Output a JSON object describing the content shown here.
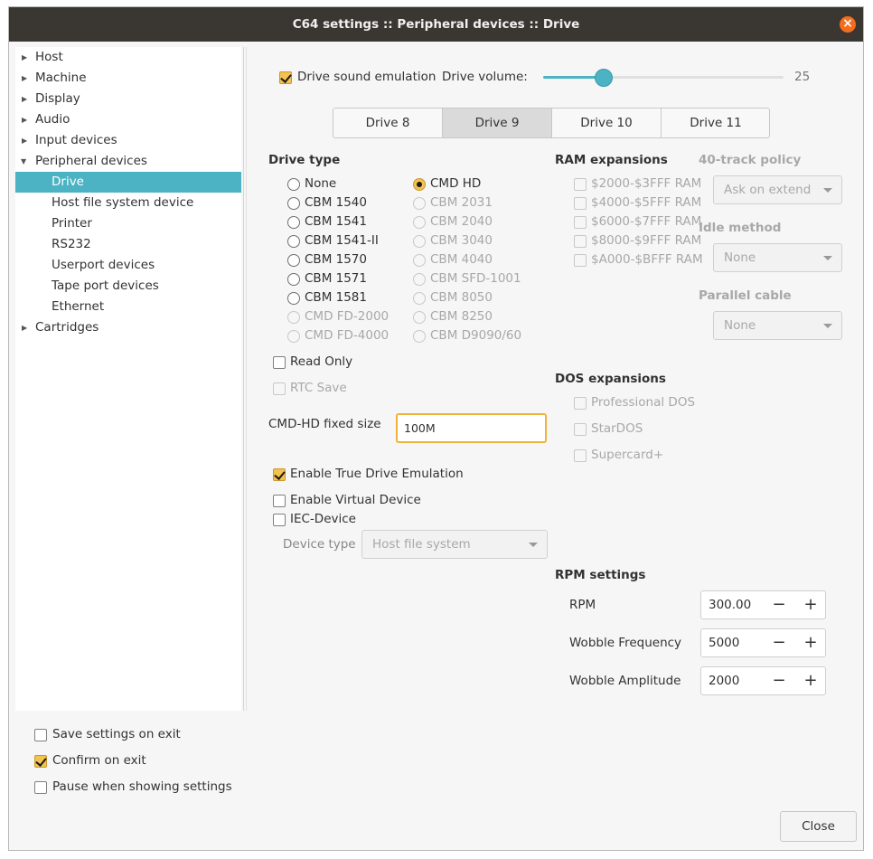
{
  "window": {
    "title": "C64 settings :: Peripheral devices :: Drive"
  },
  "colors": {
    "accent": "#4bb3c3",
    "checked": "#f3c24f",
    "titlebar": "#3a3632",
    "close": "#f46d1d"
  },
  "tree": {
    "items": [
      {
        "label": "Host"
      },
      {
        "label": "Machine"
      },
      {
        "label": "Display"
      },
      {
        "label": "Audio"
      },
      {
        "label": "Input devices"
      },
      {
        "label": "Peripheral devices"
      },
      {
        "label": "Drive"
      },
      {
        "label": "Host file system device"
      },
      {
        "label": "Printer"
      },
      {
        "label": "RS232"
      },
      {
        "label": "Userport devices"
      },
      {
        "label": "Tape port devices"
      },
      {
        "label": "Ethernet"
      },
      {
        "label": "Cartridges"
      }
    ]
  },
  "bottom": {
    "save_on_exit": "Save settings on exit",
    "confirm_on_exit": "Confirm on exit",
    "pause_when_showing": "Pause when showing settings",
    "close": "Close"
  },
  "sound": {
    "label": "Drive sound emulation",
    "volume_label": "Drive volume:",
    "volume": "25"
  },
  "tabs": [
    "Drive 8",
    "Drive 9",
    "Drive 10",
    "Drive 11"
  ],
  "drive_type": {
    "title": "Drive type",
    "col1": [
      "None",
      "CBM 1540",
      "CBM 1541",
      "CBM 1541-II",
      "CBM 1570",
      "CBM 1571",
      "CBM 1581",
      "CMD FD-2000",
      "CMD FD-4000"
    ],
    "col2": [
      "CMD HD",
      "CBM 2031",
      "CBM 2040",
      "CBM 3040",
      "CBM 4040",
      "CBM SFD-1001",
      "CBM 8050",
      "CBM 8250",
      "CBM D9090/60"
    ]
  },
  "ram": {
    "title": "RAM expansions",
    "items": [
      "$2000-$3FFF RAM",
      "$4000-$5FFF RAM",
      "$6000-$7FFF RAM",
      "$8000-$9FFF RAM",
      "$A000-$BFFF RAM"
    ]
  },
  "track40": {
    "title": "40-track policy",
    "value": "Ask on extend"
  },
  "idle": {
    "title": "Idle method",
    "value": "None"
  },
  "parallel": {
    "title": "Parallel cable",
    "value": "None"
  },
  "options": {
    "read_only": "Read Only",
    "rtc_save": "RTC Save",
    "cmdhd_label": "CMD-HD fixed size",
    "cmdhd_value": "100M",
    "true_drive": "Enable True Drive Emulation",
    "virtual_device": "Enable Virtual Device",
    "iec_device": "IEC-Device",
    "device_type_label": "Device type",
    "device_type_value": "Host file system"
  },
  "dos": {
    "title": "DOS expansions",
    "items": [
      "Professional DOS",
      "StarDOS",
      "Supercard+"
    ]
  },
  "rpm": {
    "title": "RPM settings",
    "rows": [
      {
        "label": "RPM",
        "value": "300.00"
      },
      {
        "label": "Wobble Frequency",
        "value": "5000"
      },
      {
        "label": "Wobble Amplitude",
        "value": "2000"
      }
    ],
    "minus": "−",
    "plus": "+"
  }
}
